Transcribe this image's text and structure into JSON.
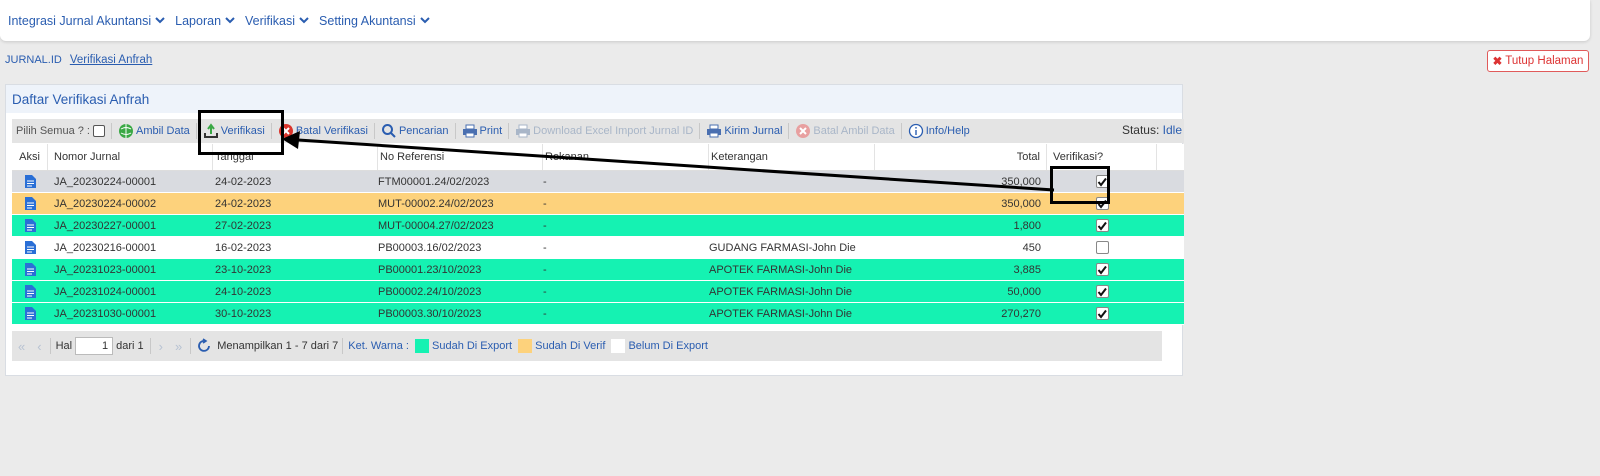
{
  "nav": {
    "items": [
      {
        "label": "Integrasi Jurnal Akuntansi"
      },
      {
        "label": "Laporan"
      },
      {
        "label": "Verifikasi"
      },
      {
        "label": "Setting Akuntansi"
      }
    ]
  },
  "breadcrumb": {
    "root": "JURNAL.ID",
    "current": "Verifikasi Anfrah"
  },
  "close_button": {
    "label": "Tutup Halaman"
  },
  "panel": {
    "title": "Daftar Verifikasi Anfrah"
  },
  "toolbar": {
    "select_all": "Pilih Semua ? :",
    "ambil_data": "Ambil Data",
    "verifikasi": "Verifikasi",
    "batal_verifikasi": "Batal Verifikasi",
    "pencarian": "Pencarian",
    "print": "Print",
    "download": "Download Excel Import Jurnal ID",
    "kirim_jurnal": "Kirim Jurnal",
    "batal_ambil": "Batal Ambil Data",
    "info": "Info/Help",
    "status_label": "Status:",
    "status_value": "Idle"
  },
  "grid": {
    "headers": {
      "aksi": "Aksi",
      "nomor": "Nomor Jurnal",
      "tanggal": "Tanggal",
      "ref": "No Referensi",
      "rekanan": "Rekanan",
      "keterangan": "Keterangan",
      "total": "Total",
      "verifikasi": "Verifikasi?"
    },
    "rows": [
      {
        "nomor": "JA_20230224-00001",
        "tanggal": "24-02-2023",
        "ref": "FTM00001.24/02/2023",
        "rekanan": "-",
        "keterangan": "",
        "total": "350,000",
        "verified": true,
        "style": "grey"
      },
      {
        "nomor": "JA_20230224-00002",
        "tanggal": "24-02-2023",
        "ref": "MUT-00002.24/02/2023",
        "rekanan": "-",
        "keterangan": "",
        "total": "350,000",
        "verified": true,
        "style": "orange"
      },
      {
        "nomor": "JA_20230227-00001",
        "tanggal": "27-02-2023",
        "ref": "MUT-00004.27/02/2023",
        "rekanan": "-",
        "keterangan": "",
        "total": "1,800",
        "verified": true,
        "style": "green"
      },
      {
        "nomor": "JA_20230216-00001",
        "tanggal": "16-02-2023",
        "ref": "PB00003.16/02/2023",
        "rekanan": "-",
        "keterangan": "GUDANG FARMASI-John Die",
        "total": "450",
        "verified": false,
        "style": "white"
      },
      {
        "nomor": "JA_20231023-00001",
        "tanggal": "23-10-2023",
        "ref": "PB00001.23/10/2023",
        "rekanan": "-",
        "keterangan": "APOTEK FARMASI-John Die",
        "total": "3,885",
        "verified": true,
        "style": "green"
      },
      {
        "nomor": "JA_20231024-00001",
        "tanggal": "24-10-2023",
        "ref": "PB00002.24/10/2023",
        "rekanan": "-",
        "keterangan": "APOTEK FARMASI-John Die",
        "total": "50,000",
        "verified": true,
        "style": "green"
      },
      {
        "nomor": "JA_20231030-00001",
        "tanggal": "30-10-2023",
        "ref": "PB00003.30/10/2023",
        "rekanan": "-",
        "keterangan": "APOTEK FARMASI-John Die",
        "total": "270,270",
        "verified": true,
        "style": "green"
      }
    ]
  },
  "pager": {
    "hal_label": "Hal",
    "page": "1",
    "of_label": "dari 1",
    "showing": "Menampilkan 1 - 7 dari 7",
    "legend_label": "Ket. Warna :",
    "legend": [
      {
        "label": "Sudah Di Export",
        "color": "#15f2b2"
      },
      {
        "label": "Sudah Di Verif",
        "color": "#fdd27c"
      },
      {
        "label": "Belum Di Export",
        "color": "#ffffff"
      }
    ]
  },
  "colors": {
    "accent": "#2a5db0",
    "row_grey": "#d9dbe0",
    "row_orange": "#fdd27c",
    "row_green": "#15f2b2"
  }
}
